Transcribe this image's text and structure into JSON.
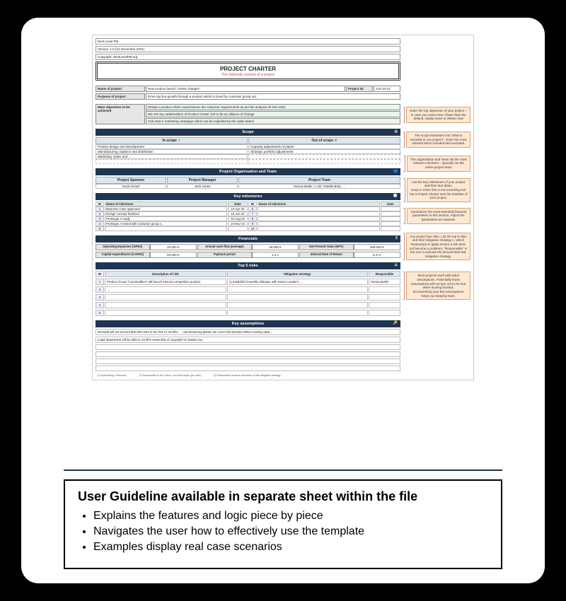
{
  "meta": {
    "org": "Next Level PM",
    "version": "Version: 1.5 (21 December 2021)",
    "copyright": "Copyright: NextLevelPM.org"
  },
  "title": {
    "main": "PROJECT CHARTER",
    "sub": "The (internal) contract of a project"
  },
  "fields": {
    "name_label": "Name of project",
    "name_value": "New product launch \"Game changer\"",
    "id_label": "Project ID:",
    "id_value": "123-10-22",
    "purpose_label": "Purpose of project",
    "purpose_value": "Drive top line growth through a product which is loved by customer group xyz.",
    "objectives_label": "Main objectives to be achieved",
    "obj1": "Design a product which overachieves the customer requirements as per the analysis 20 Nov 2021",
    "obj2": "Win the key stakeholders of Product Center 123 to be an alliance of change",
    "obj3": "Kick-start a marketing campaign which can be exploited by the sales teams"
  },
  "scope": {
    "header": "Scope",
    "in_label": "In scope",
    "out_label": "Out of scope",
    "in": [
      "Product design and development",
      "Manufacturing, logistics and distribution",
      "Marketing, Sales and …"
    ],
    "out": [
      "Capacity adjustments of plants",
      "Strategic portfolio adjustments"
    ]
  },
  "org_team": {
    "header": "Project Organisation and Team",
    "sponsor_label": "Project Sponsor",
    "sponsor": "Suzie Smart",
    "pm_label": "Project Manager",
    "pm": "Jack Jones",
    "team_label": "Project Team",
    "team": "Hanna Muller; Li Dir; Natalie Bela; …"
  },
  "milestones": {
    "header": "Key milestones",
    "cols": {
      "id": "ID",
      "name": "Name of milestone",
      "date": "Date"
    },
    "left": [
      {
        "id": "1",
        "name": "Business Case approved",
        "date": "10-Apr-22"
      },
      {
        "id": "2",
        "name": "Design concept finalized",
        "date": "15-Jun-22"
      },
      {
        "id": "3",
        "name": "Prototype A ready",
        "date": "10-Aug-22"
      },
      {
        "id": "4",
        "name": "Prototype A tested with customer group x…",
        "date": "10-Nov-22"
      },
      {
        "id": "5",
        "name": "",
        "date": ""
      }
    ],
    "right": [
      {
        "id": "6",
        "name": "",
        "date": ""
      },
      {
        "id": "7",
        "name": "",
        "date": ""
      },
      {
        "id": "8",
        "name": "",
        "date": ""
      },
      {
        "id": "9",
        "name": "",
        "date": ""
      },
      {
        "id": "10",
        "name": "",
        "date": ""
      }
    ]
  },
  "financials": {
    "header": "Financials",
    "opex_label": "Operating Expenses (OPEX)",
    "opex": "34.000 €",
    "capex_label": "Capital expenditures (CAPEX)",
    "capex": "25.600 €",
    "cash_label": "Annual cash flow (average)",
    "cash": "18.000 €",
    "payback_label": "Payback period",
    "payback": "1,4",
    "payback_unit": "y",
    "npv_label": "Net Present Value (NPV)",
    "npv": "185.000 €",
    "irr_label": "Internal Rate of Return",
    "irr": "8,4",
    "irr_unit": "%"
  },
  "risks": {
    "header": "Top 5 risks",
    "cols": {
      "id": "ID",
      "desc": "Description of risk",
      "mit": "Mitigation strategy",
      "resp": "Responsible"
    },
    "rows": [
      {
        "id": "1",
        "desc": "Product Group \"Commodities\" will launch internal competition product",
        "mit": "1) Establish bi-weekly dialogue with Senior Leaders …",
        "resp": "Hanna Muller"
      },
      {
        "id": "2",
        "desc": "…",
        "mit": "…",
        "resp": ""
      },
      {
        "id": "3",
        "desc": "",
        "mit": "",
        "resp": ""
      },
      {
        "id": "4",
        "desc": "",
        "mit": "",
        "resp": ""
      },
      {
        "id": "5",
        "desc": "",
        "mit": "",
        "resp": ""
      }
    ]
  },
  "assumptions": {
    "header": "Key assumptions",
    "rows": [
      "Demand will not exceed 500.000 units in the first 12 months → manufacturing plants can cover this demand within existing capa…",
      "Legal department will be able to confirm ownership of copyright for feature xxx",
      "",
      "",
      "",
      ""
    ]
  },
  "footer": {
    "a": "1) Supervising • Executive",
    "b": "2) Responsible to be in time, cost and scope (per plan)",
    "c": "3) Responsible is about execution of risk mitigation strategy"
  },
  "hints": {
    "objectives": "Enter the top objectives of your project – in case you need more / fewer than the default, simply insert or delete rows",
    "scope": "The scope translates into \"what is included in our project?\". Enter the most relevant items included and excluded.",
    "org": "The organisation and Team list the most relevant members – typically not the entire project team",
    "milestones": "List the key milestones of your project and their due dates.\nKeep in mind: this is not a tracking tool but a Project Charter sets the baseline of your project.",
    "financials": "Summarize the most essential financial parameters in this section. Adjust the parameters as required.",
    "risks": "Any project has risks. List the top 5 risks and their mitigation strategy (= which measure(s) to apply ensure a risk does not become a problem). \"Responsible\" is the one to execute the documented risk mitigation strategy.",
    "assumptions": "Most projects work with initial assumptions. Potentially those assumptions will not turn out to be true when moving forward.\nDocumenting your key assumptions helps you keeping track."
  },
  "guideline": {
    "title": "User Guideline available in separate sheet within the file",
    "b1": "Explains the features and logic piece by piece",
    "b2": "Navigates the user how to effectively use the template",
    "b3": "Examples display real case scenarios"
  }
}
